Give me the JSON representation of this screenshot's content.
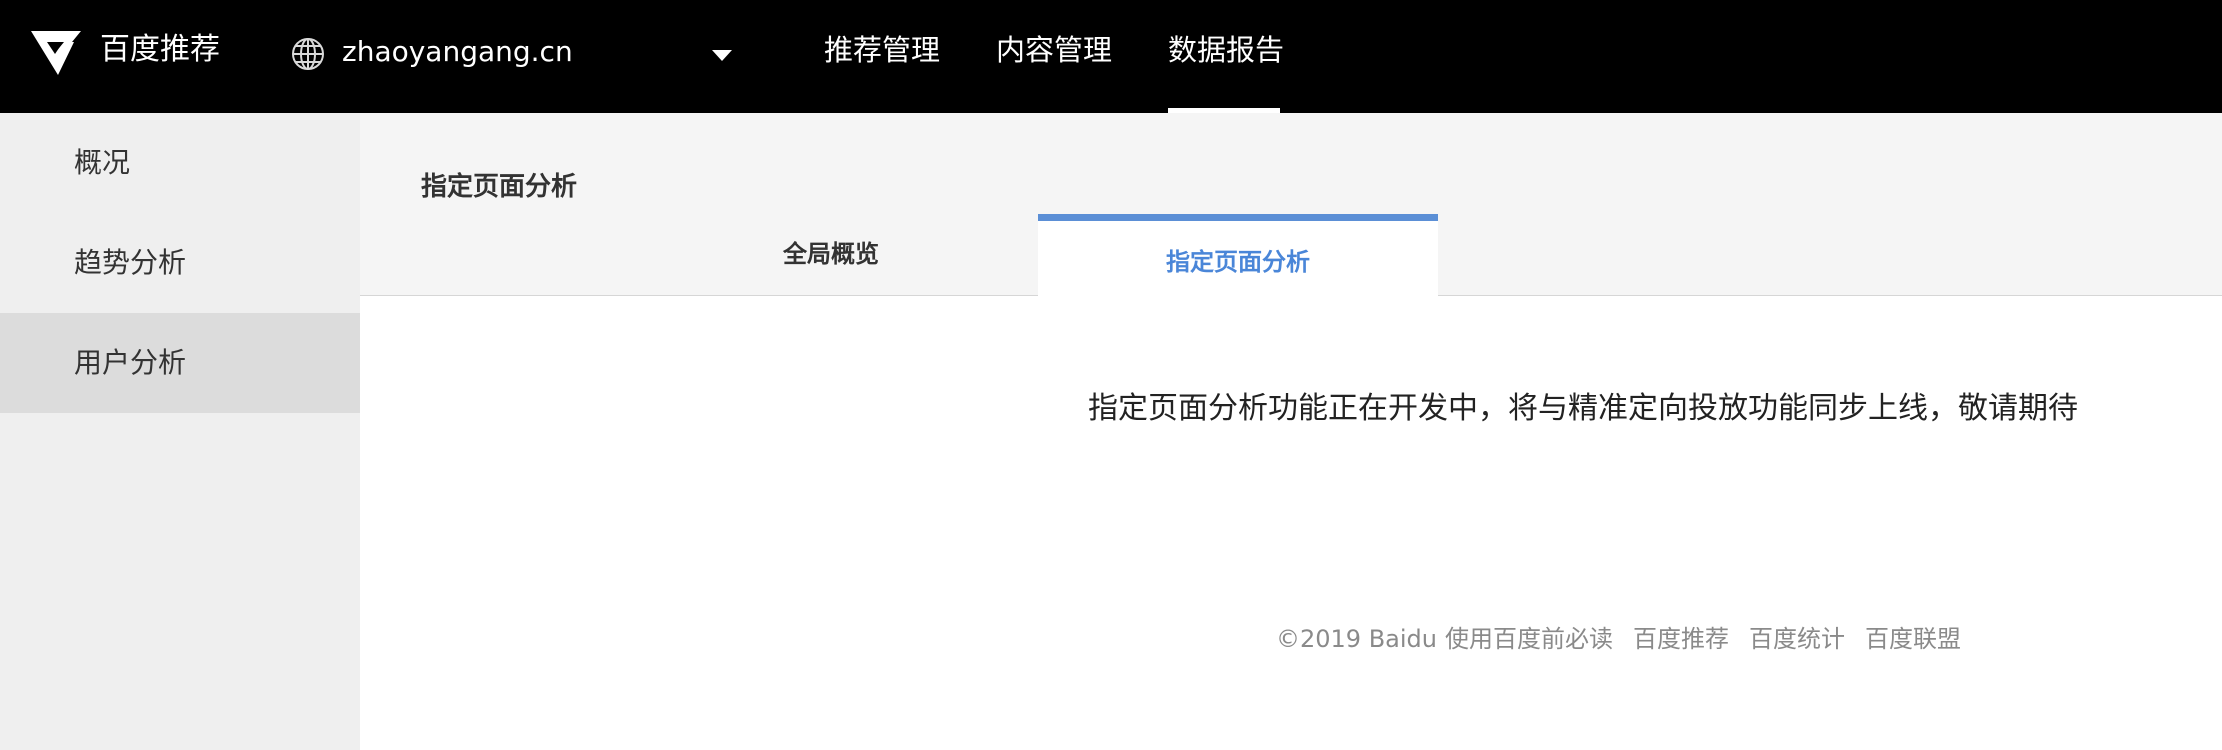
{
  "header": {
    "brand": "百度推荐",
    "site": "zhaoyangang.cn",
    "nav": [
      {
        "label": "推荐管理"
      },
      {
        "label": "内容管理"
      },
      {
        "label": "数据报告",
        "active": true
      }
    ]
  },
  "sidebar": {
    "items": [
      {
        "label": "概况"
      },
      {
        "label": "趋势分析"
      },
      {
        "label": "用户分析",
        "active": true
      }
    ]
  },
  "main": {
    "title": "指定页面分析",
    "tabs": [
      {
        "label": "全局概览"
      },
      {
        "label": "指定页面分析",
        "active": true
      }
    ],
    "notice": "指定页面分析功能正在开发中，将与精准定向投放功能同步上线，敬请期待"
  },
  "footer": {
    "copyright": "©2019 Baidu",
    "links": [
      "使用百度前必读",
      "百度推荐",
      "百度统计",
      "百度联盟"
    ]
  },
  "colors": {
    "topbar": "#000000",
    "sidebar": "#efefef",
    "sidebar_active": "#dcdcdc",
    "tab_accent": "#5b8fd6",
    "tab_active_text": "#4a86d8"
  },
  "icons": {
    "logo": "baidu-recommend-logo",
    "site": "globe-icon",
    "dropdown": "caret-down-icon"
  }
}
